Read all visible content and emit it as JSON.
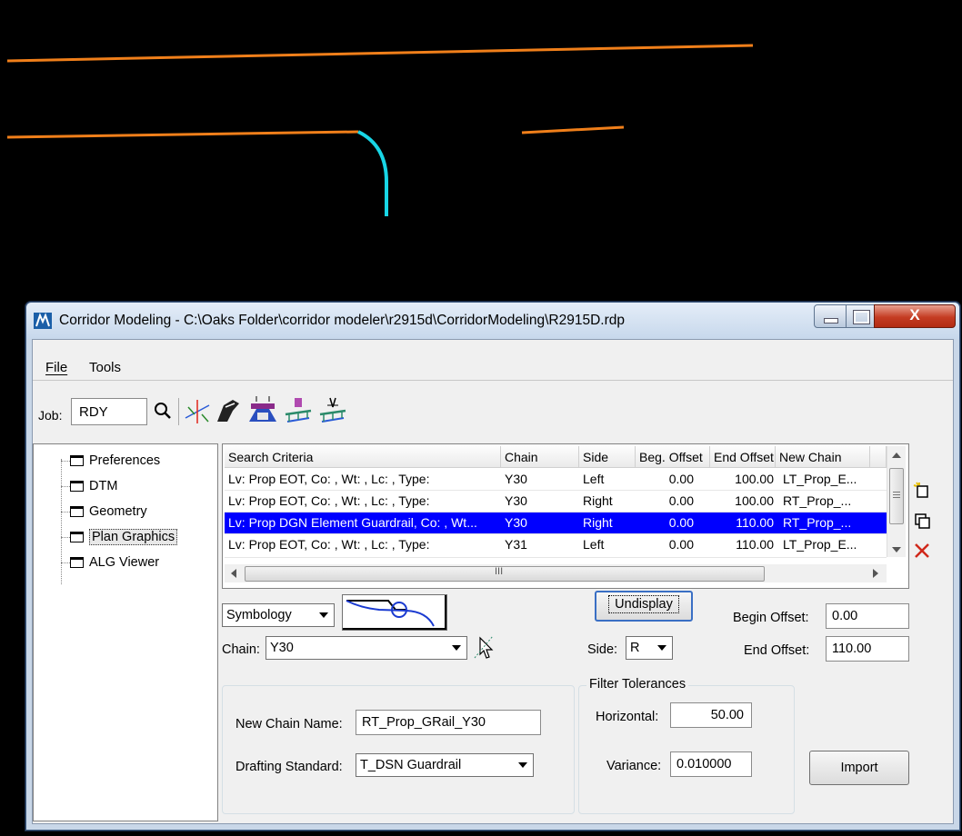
{
  "window": {
    "title": "Corridor Modeling - C:\\Oaks Folder\\corridor modeler\\r2915d\\CorridorModeling\\R2915D.rdp",
    "close_label": "X"
  },
  "menu": {
    "file": "File",
    "tools": "Tools"
  },
  "toolbar": {
    "job_label": "Job:",
    "job_value": "RDY",
    "icons": [
      "search-icon",
      "alignment-icon",
      "template-icon",
      "roadway-designer-icon",
      "superelevation-icon",
      "transition-icon"
    ]
  },
  "tree": {
    "items": [
      {
        "label": "Preferences"
      },
      {
        "label": "DTM"
      },
      {
        "label": "Geometry"
      },
      {
        "label": "Plan Graphics",
        "selected": true
      },
      {
        "label": "ALG Viewer"
      }
    ]
  },
  "grid": {
    "headers": [
      "Search Criteria",
      "Chain",
      "Side",
      "Beg. Offset",
      "End Offset",
      "New Chain"
    ],
    "rows": [
      [
        "Lv: Prop EOT, Co: , Wt: , Lc: , Type:",
        "Y30",
        "Left",
        "0.00",
        "100.00",
        "LT_Prop_E..."
      ],
      [
        "Lv: Prop EOT, Co: , Wt: , Lc: , Type:",
        "Y30",
        "Right",
        "0.00",
        "100.00",
        "RT_Prop_..."
      ],
      [
        "Lv: Prop DGN Element Guardrail, Co: , Wt...",
        "Y30",
        "Right",
        "0.00",
        "110.00",
        "RT_Prop_..."
      ],
      [
        "Lv: Prop EOT, Co: , Wt: , Lc: , Type:",
        "Y31",
        "Left",
        "0.00",
        "110.00",
        "LT_Prop_E..."
      ]
    ],
    "selected_row": 2,
    "hscroll_marker": "III"
  },
  "side_icons": [
    "add-icon",
    "copy-icon",
    "delete-icon"
  ],
  "symbology": {
    "value": "Symbology"
  },
  "chain": {
    "label": "Chain:",
    "value": "Y30"
  },
  "undisplay_label": "Undisplay",
  "side": {
    "label": "Side:",
    "value": "R"
  },
  "begin_offset": {
    "label": "Begin Offset:",
    "value": "0.00"
  },
  "end_offset": {
    "label": "End Offset:",
    "value": "110.00"
  },
  "new_chain": {
    "label": "New Chain Name:",
    "value": "RT_Prop_GRail_Y30"
  },
  "drafting": {
    "label": "Drafting Standard:",
    "value": "T_DSN Guardrail"
  },
  "filter": {
    "title": "Filter Tolerances",
    "horizontal_label": "Horizontal:",
    "horizontal_value": "50.00",
    "variance_label": "Variance:",
    "variance_value": "0.010000"
  },
  "import_label": "Import",
  "colors": {
    "orange_line": "#f07f1a",
    "cyan_line": "#18d6e6",
    "selection": "#0000ff"
  }
}
